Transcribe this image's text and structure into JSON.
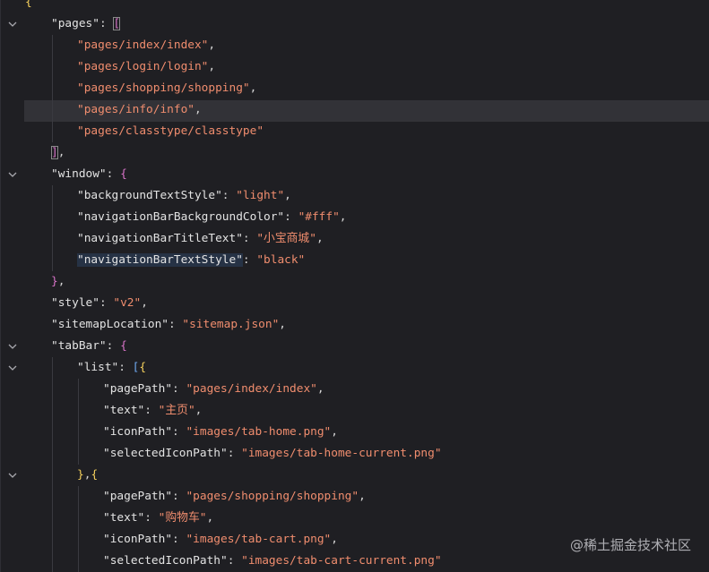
{
  "lines": [
    {
      "indent": 0,
      "fold": false,
      "segments": [
        {
          "t": "{",
          "c": "brace"
        }
      ]
    },
    {
      "indent": 1,
      "fold": true,
      "segments": [
        {
          "t": "\"pages\"",
          "c": "key"
        },
        {
          "t": ": ",
          "c": "pun"
        },
        {
          "t": "[",
          "c": "bracket-pink",
          "box": true
        }
      ]
    },
    {
      "indent": 2,
      "fold": false,
      "segments": [
        {
          "t": "\"pages/index/index\"",
          "c": "str"
        },
        {
          "t": ",",
          "c": "pun"
        }
      ]
    },
    {
      "indent": 2,
      "fold": false,
      "segments": [
        {
          "t": "\"pages/login/login\"",
          "c": "str"
        },
        {
          "t": ",",
          "c": "pun"
        }
      ]
    },
    {
      "indent": 2,
      "fold": false,
      "segments": [
        {
          "t": "\"pages/shopping/shopping\"",
          "c": "str"
        },
        {
          "t": ",",
          "c": "pun"
        }
      ]
    },
    {
      "indent": 2,
      "fold": false,
      "segments": [
        {
          "t": "\"pages/info/info\"",
          "c": "str"
        },
        {
          "t": ",",
          "c": "pun"
        }
      ]
    },
    {
      "indent": 2,
      "fold": false,
      "segments": [
        {
          "t": "\"pages/classtype/classtype\"",
          "c": "str"
        }
      ]
    },
    {
      "indent": 1,
      "fold": false,
      "segments": [
        {
          "t": "]",
          "c": "bracket-pink",
          "box": true
        },
        {
          "t": ",",
          "c": "pun"
        }
      ]
    },
    {
      "indent": 1,
      "fold": true,
      "segments": [
        {
          "t": "\"window\"",
          "c": "key"
        },
        {
          "t": ": ",
          "c": "pun"
        },
        {
          "t": "{",
          "c": "bracket-pink"
        }
      ]
    },
    {
      "indent": 2,
      "fold": false,
      "segments": [
        {
          "t": "\"backgroundTextStyle\"",
          "c": "key"
        },
        {
          "t": ": ",
          "c": "pun"
        },
        {
          "t": "\"light\"",
          "c": "str"
        },
        {
          "t": ",",
          "c": "pun"
        }
      ]
    },
    {
      "indent": 2,
      "fold": false,
      "segments": [
        {
          "t": "\"navigationBarBackgroundColor\"",
          "c": "key"
        },
        {
          "t": ": ",
          "c": "pun"
        },
        {
          "t": "\"#fff\"",
          "c": "str"
        },
        {
          "t": ",",
          "c": "pun"
        }
      ]
    },
    {
      "indent": 2,
      "fold": false,
      "segments": [
        {
          "t": "\"navigationBarTitleText\"",
          "c": "key"
        },
        {
          "t": ": ",
          "c": "pun"
        },
        {
          "t": "\"小宝商城\"",
          "c": "str"
        },
        {
          "t": ",",
          "c": "pun"
        }
      ]
    },
    {
      "indent": 2,
      "fold": false,
      "segments": [
        {
          "t": "\"navigationBarTextStyle\"",
          "c": "key",
          "sel": true
        },
        {
          "t": ": ",
          "c": "pun"
        },
        {
          "t": "\"black\"",
          "c": "str"
        }
      ]
    },
    {
      "indent": 1,
      "fold": false,
      "segments": [
        {
          "t": "}",
          "c": "bracket-pink"
        },
        {
          "t": ",",
          "c": "pun"
        }
      ]
    },
    {
      "indent": 1,
      "fold": false,
      "segments": [
        {
          "t": "\"style\"",
          "c": "key"
        },
        {
          "t": ": ",
          "c": "pun"
        },
        {
          "t": "\"v2\"",
          "c": "str"
        },
        {
          "t": ",",
          "c": "pun"
        }
      ]
    },
    {
      "indent": 1,
      "fold": false,
      "segments": [
        {
          "t": "\"sitemapLocation\"",
          "c": "key"
        },
        {
          "t": ": ",
          "c": "pun"
        },
        {
          "t": "\"sitemap.json\"",
          "c": "str"
        },
        {
          "t": ",",
          "c": "pun"
        }
      ]
    },
    {
      "indent": 1,
      "fold": true,
      "segments": [
        {
          "t": "\"tabBar\"",
          "c": "key"
        },
        {
          "t": ": ",
          "c": "pun"
        },
        {
          "t": "{",
          "c": "bracket-pink"
        }
      ]
    },
    {
      "indent": 2,
      "fold": true,
      "segments": [
        {
          "t": "\"list\"",
          "c": "key"
        },
        {
          "t": ": ",
          "c": "pun"
        },
        {
          "t": "[",
          "c": "bracket-blue"
        },
        {
          "t": "{",
          "c": "brace"
        }
      ]
    },
    {
      "indent": 3,
      "fold": false,
      "segments": [
        {
          "t": "\"pagePath\"",
          "c": "key"
        },
        {
          "t": ": ",
          "c": "pun"
        },
        {
          "t": "\"pages/index/index\"",
          "c": "str"
        },
        {
          "t": ",",
          "c": "pun"
        }
      ]
    },
    {
      "indent": 3,
      "fold": false,
      "segments": [
        {
          "t": "\"text\"",
          "c": "key"
        },
        {
          "t": ": ",
          "c": "pun"
        },
        {
          "t": "\"主页\"",
          "c": "str"
        },
        {
          "t": ",",
          "c": "pun"
        }
      ]
    },
    {
      "indent": 3,
      "fold": false,
      "segments": [
        {
          "t": "\"iconPath\"",
          "c": "key"
        },
        {
          "t": ": ",
          "c": "pun"
        },
        {
          "t": "\"images/tab-home.png\"",
          "c": "str"
        },
        {
          "t": ",",
          "c": "pun"
        }
      ]
    },
    {
      "indent": 3,
      "fold": false,
      "segments": [
        {
          "t": "\"selectedIconPath\"",
          "c": "key"
        },
        {
          "t": ": ",
          "c": "pun"
        },
        {
          "t": "\"images/tab-home-current.png\"",
          "c": "str"
        }
      ]
    },
    {
      "indent": 2,
      "fold": true,
      "segments": [
        {
          "t": "}",
          "c": "brace"
        },
        {
          "t": ",",
          "c": "pun"
        },
        {
          "t": "{",
          "c": "brace"
        }
      ]
    },
    {
      "indent": 3,
      "fold": false,
      "segments": [
        {
          "t": "\"pagePath\"",
          "c": "key"
        },
        {
          "t": ": ",
          "c": "pun"
        },
        {
          "t": "\"pages/shopping/shopping\"",
          "c": "str"
        },
        {
          "t": ",",
          "c": "pun"
        }
      ]
    },
    {
      "indent": 3,
      "fold": false,
      "segments": [
        {
          "t": "\"text\"",
          "c": "key"
        },
        {
          "t": ": ",
          "c": "pun"
        },
        {
          "t": "\"购物车\"",
          "c": "str"
        },
        {
          "t": ",",
          "c": "pun"
        }
      ]
    },
    {
      "indent": 3,
      "fold": false,
      "segments": [
        {
          "t": "\"iconPath\"",
          "c": "key"
        },
        {
          "t": ": ",
          "c": "pun"
        },
        {
          "t": "\"images/tab-cart.png\"",
          "c": "str"
        },
        {
          "t": ",",
          "c": "pun"
        }
      ]
    },
    {
      "indent": 3,
      "fold": false,
      "segments": [
        {
          "t": "\"selectedIconPath\"",
          "c": "key"
        },
        {
          "t": ": ",
          "c": "pun"
        },
        {
          "t": "\"images/tab-cart-current.png\"",
          "c": "str"
        }
      ]
    }
  ],
  "current_line_index": 5,
  "watermark": "@稀土掘金技术社区",
  "colors": {
    "background": "#1f1f23",
    "current_line": "#323237",
    "string": "#f08d6e",
    "key": "#e3e3e3",
    "brace": "#f4cf5c",
    "bracket_pink": "#d873c8",
    "bracket_blue": "#6fa8f0"
  },
  "icons": {
    "fold": "chevron-down-icon"
  }
}
